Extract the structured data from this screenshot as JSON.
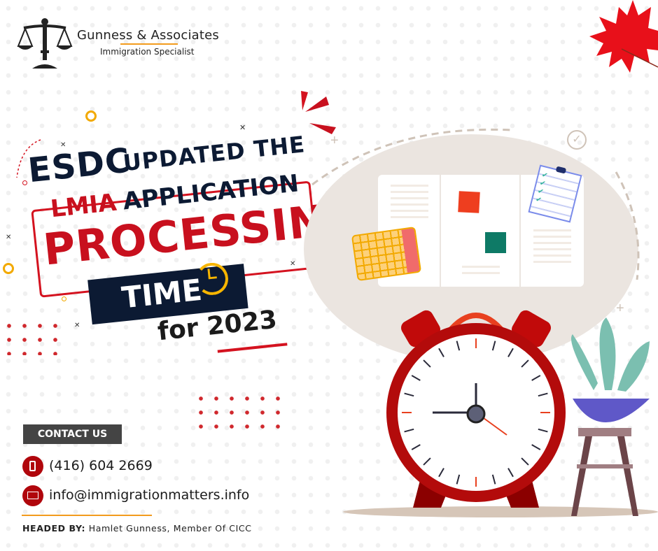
{
  "brand": {
    "name": "Gunness & Associates",
    "tagline": "Immigration Specialist",
    "logo_icon": "scales-of-justice-icon",
    "accent_color": "#f29b1d"
  },
  "headline": {
    "line1_big": "ESDC",
    "line1_rest": "UPDATED THE",
    "line2_red": "LMIA",
    "line2_rest": "APPLICATION",
    "line3": "PROCESSING",
    "line4": "TIME",
    "line5": "for 2023",
    "colors": {
      "navy": "#0c1a33",
      "red": "#c8101e"
    }
  },
  "contact": {
    "button_label": "CONTACT US",
    "phone": "(416) 604 2669",
    "email": "info@immigrationmatters.info",
    "phone_icon": "phone-icon",
    "email_icon": "envelope-icon"
  },
  "footer": {
    "headed_label": "HEADED BY:",
    "headed_value": "Hamlet Gunness, Member Of CICC"
  },
  "illustration": {
    "items": [
      "maple-leaf",
      "alarm-clock",
      "plant-on-stool",
      "calendar",
      "sticky-notes",
      "checklist-clipboard",
      "checkmark-circle"
    ]
  }
}
